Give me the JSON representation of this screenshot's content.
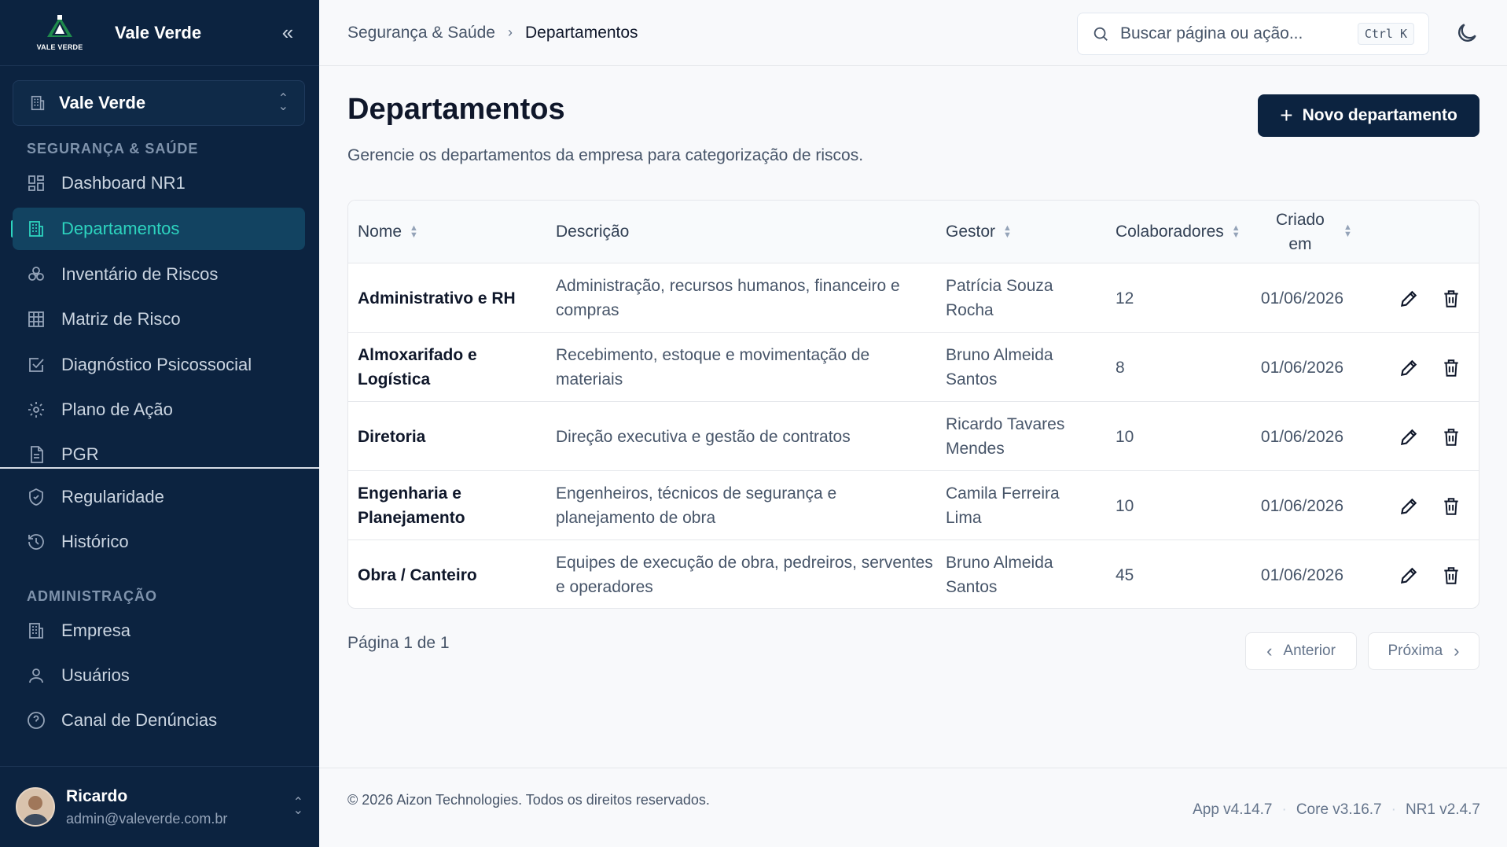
{
  "brand": {
    "name": "Vale Verde",
    "logo_text": "VALE VERDE"
  },
  "org_selector": {
    "label": "Vale Verde"
  },
  "sidebar": {
    "sections": [
      {
        "title": "SEGURANÇA & SAÚDE"
      },
      {
        "title": "ADMINISTRAÇÃO"
      }
    ],
    "items": [
      {
        "label": "Dashboard NR1",
        "icon": "dashboard-icon"
      },
      {
        "label": "Departamentos",
        "icon": "building-icon",
        "active": true
      },
      {
        "label": "Inventário de Riscos",
        "icon": "biohazard-icon"
      },
      {
        "label": "Matriz de Risco",
        "icon": "grid-icon"
      },
      {
        "label": "Diagnóstico Psicossocial",
        "icon": "checkbox-icon"
      },
      {
        "label": "Plano de Ação",
        "icon": "gear-icon"
      },
      {
        "label": "PGR",
        "icon": "document-icon"
      },
      {
        "label": "Regularidade",
        "icon": "shield-icon"
      },
      {
        "label": "Histórico",
        "icon": "history-icon"
      },
      {
        "label": "Empresa",
        "icon": "building-icon"
      },
      {
        "label": "Usuários",
        "icon": "user-icon"
      },
      {
        "label": "Canal de Denúncias",
        "icon": "help-circle-icon"
      }
    ]
  },
  "user": {
    "name": "Ricardo",
    "email": "admin@valeverde.com.br"
  },
  "breadcrumb": {
    "parent": "Segurança & Saúde",
    "current": "Departamentos"
  },
  "search": {
    "placeholder": "Buscar página ou ação...",
    "shortcut": "Ctrl K"
  },
  "page": {
    "title": "Departamentos",
    "subtitle": "Gerencie os departamentos da empresa para categorização de riscos.",
    "new_button": "Novo departamento"
  },
  "table": {
    "columns": [
      "Nome",
      "Descrição",
      "Gestor",
      "Colaboradores",
      "Criado em"
    ],
    "rows": [
      {
        "name": "Administrativo e RH",
        "description": "Administração, recursos humanos, financeiro e compras",
        "manager": "Patrícia Souza Rocha",
        "count": "12",
        "created": "01/06/2026"
      },
      {
        "name": "Almoxarifado e Logística",
        "description": "Recebimento, estoque e movimentação de materiais",
        "manager": "Bruno Almeida Santos",
        "count": "8",
        "created": "01/06/2026"
      },
      {
        "name": "Diretoria",
        "description": "Direção executiva e gestão de contratos",
        "manager": "Ricardo Tavares Mendes",
        "count": "10",
        "created": "01/06/2026"
      },
      {
        "name": "Engenharia e Planejamento",
        "description": "Engenheiros, técnicos de segurança e planejamento de obra",
        "manager": "Camila Ferreira Lima",
        "count": "10",
        "created": "01/06/2026"
      },
      {
        "name": "Obra / Canteiro",
        "description": "Equipes de execução de obra, pedreiros, serventes e operadores",
        "manager": "Bruno Almeida Santos",
        "count": "45",
        "created": "01/06/2026"
      }
    ]
  },
  "pagination": {
    "text": "Página 1 de 1",
    "prev": "Anterior",
    "next": "Próxima"
  },
  "footer": {
    "copyright": "© 2026 Aizon Technologies. Todos os direitos reservados.",
    "versions": [
      "App v4.14.7",
      "Core v3.16.7",
      "NR1 v2.4.7"
    ]
  },
  "colors": {
    "sidebar_bg": "#0c2340",
    "accent": "#2dd4bf",
    "primary_button": "#0c2340"
  }
}
